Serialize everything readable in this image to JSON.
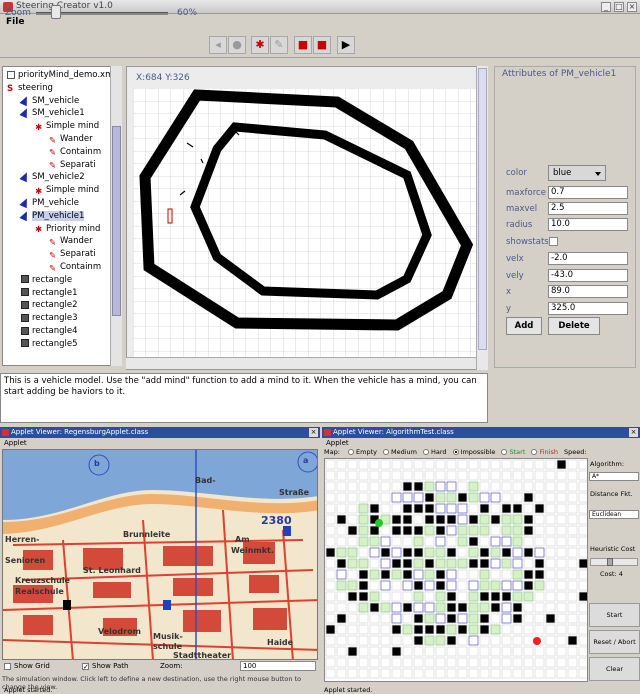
{
  "window": {
    "title": "Steering Creator v1.0"
  },
  "menu": {
    "file": "File"
  },
  "toolbar": {
    "zoom_label": "Zoom",
    "zoom_value": "60%",
    "zoom_level": 0.12,
    "icons": [
      "vehicle-tool-icon",
      "obstacle-tool-icon",
      "mind-tool-icon",
      "behavior-tool-icon",
      "mind-add-icon",
      "mind-remove-icon",
      "play-icon"
    ]
  },
  "tree": {
    "items": [
      {
        "label": "priorityMind_demo.xml",
        "icon": "document-icon",
        "indent": 0
      },
      {
        "label": "steering",
        "icon": "steering-icon",
        "indent": 0
      },
      {
        "label": "SM_vehicle",
        "icon": "vehicle-icon",
        "indent": 1
      },
      {
        "label": "SM_vehicle1",
        "icon": "vehicle-icon",
        "indent": 1
      },
      {
        "label": "Simple mind",
        "icon": "mind-icon",
        "indent": 2
      },
      {
        "label": "Wander",
        "icon": "behavior-icon",
        "indent": 3
      },
      {
        "label": "Containm",
        "icon": "behavior-icon",
        "indent": 3
      },
      {
        "label": "Separati",
        "icon": "behavior-icon",
        "indent": 3
      },
      {
        "label": "SM_vehicle2",
        "icon": "vehicle-icon",
        "indent": 1
      },
      {
        "label": "Simple mind",
        "icon": "mind-icon",
        "indent": 2
      },
      {
        "label": "PM_vehicle",
        "icon": "vehicle-icon",
        "indent": 1
      },
      {
        "label": "PM_vehicle1",
        "icon": "vehicle-icon",
        "indent": 1,
        "selected": true
      },
      {
        "label": "Priority mind",
        "icon": "mind-icon",
        "indent": 2
      },
      {
        "label": "Wander",
        "icon": "behavior-icon",
        "indent": 3
      },
      {
        "label": "Separati",
        "icon": "behavior-icon",
        "indent": 3
      },
      {
        "label": "Containm",
        "icon": "behavior-icon",
        "indent": 3
      },
      {
        "label": "rectangle",
        "icon": "rectangle-icon",
        "indent": 1
      },
      {
        "label": "rectangle1",
        "icon": "rectangle-icon",
        "indent": 1
      },
      {
        "label": "rectangle2",
        "icon": "rectangle-icon",
        "indent": 1
      },
      {
        "label": "rectangle3",
        "icon": "rectangle-icon",
        "indent": 1
      },
      {
        "label": "rectangle4",
        "icon": "rectangle-icon",
        "indent": 1
      },
      {
        "label": "rectangle5",
        "icon": "rectangle-icon",
        "indent": 1
      }
    ]
  },
  "canvas": {
    "coords": "X:684 Y:326"
  },
  "attributes": {
    "title": "Attributes of PM_vehicle1",
    "color_label": "color",
    "color_value": "blue",
    "fields": [
      {
        "label": "maxforce",
        "value": "0.7"
      },
      {
        "label": "maxvel",
        "value": "2.5"
      },
      {
        "label": "radius",
        "value": "10.0"
      }
    ],
    "showstats_label": "showstats",
    "fields2": [
      {
        "label": "velx",
        "value": "-2.0"
      },
      {
        "label": "vely",
        "value": "-43.0"
      },
      {
        "label": "x",
        "value": "89.0"
      },
      {
        "label": "y",
        "value": "325.0"
      }
    ],
    "add_label": "Add",
    "delete_label": "Delete"
  },
  "description": {
    "text": "This is a vehicle model. Use the \"add mind\" function to add a mind to it. When the vehicle has a mind, you can start adding be haviors to it."
  },
  "applet1": {
    "title": "Applet Viewer: RegensburgApplet.class",
    "menu": "Applet",
    "map_labels": [
      "Bad-",
      "Straße",
      "2380",
      "Brunnleite",
      "Herren-",
      "Senioren",
      "Am",
      "Weinmkt.",
      "St. Leonhard",
      "Kreuzschule",
      "Realschule",
      "Velodrom",
      "Musik-",
      "schule",
      "Stadttheater",
      "Haide"
    ],
    "show_grid": "Show Grid",
    "show_path": "Show Path",
    "zoom_label": "Zoom:",
    "zoom_value": "100",
    "status": "The simulation window. Click left to define a new destination, use the right mouse button to change the view.",
    "started": "Applet started."
  },
  "applet2": {
    "title": "Applet Viewer: AlgorithmTest.class",
    "menu": "Applet",
    "map_label": "Map:",
    "radios": [
      {
        "label": "Empty",
        "on": false
      },
      {
        "label": "Medium",
        "on": false
      },
      {
        "label": "Hard",
        "on": false
      },
      {
        "label": "Impossible",
        "on": true
      }
    ],
    "start_label": "Start",
    "finish_label": "Finish",
    "speed_label": "Speed:",
    "algorithm_label": "Algorithm:",
    "algorithm_value": "A*",
    "distance_label": "Distance Fkt.",
    "distance_value": "Euclidean",
    "heuristic_label": "Heuristic Cost",
    "cost_label": "Cost: 4",
    "btn_start": "Start",
    "btn_reset": "Reset / Abort",
    "btn_clear": "Clear",
    "started": "Applet started."
  }
}
